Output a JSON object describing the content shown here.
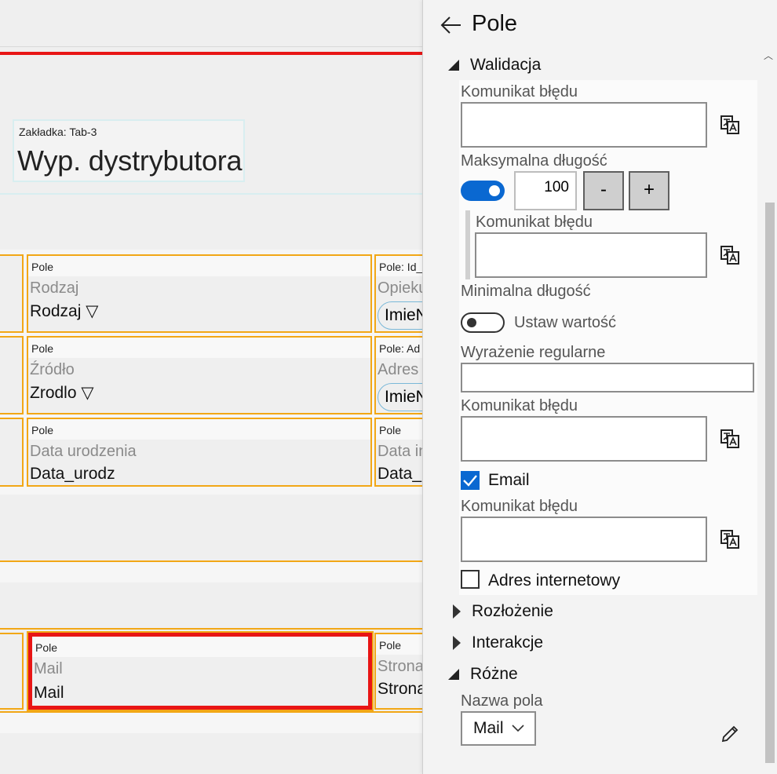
{
  "canvas": {
    "tab": {
      "caption": "Zakładka: Tab-3",
      "title": "Wyp. dystrybutora"
    },
    "fields": [
      {
        "caption": "Pole",
        "label": "Rodzaj",
        "value": "Rodzaj ▽"
      },
      {
        "caption": "Pole: Id_",
        "label": "Opieku",
        "value": "ImieN"
      },
      {
        "caption": "Pole",
        "label": "Źródło",
        "value": "Zrodlo ▽"
      },
      {
        "caption": "Pole: Ad",
        "label": "Adres n",
        "value": "ImieN"
      },
      {
        "caption": "Pole",
        "label": "Data urodzenia",
        "value": "Data_urodz"
      },
      {
        "caption": "Pole",
        "label": "Data in",
        "value": "Data_i"
      },
      {
        "caption": "Pole",
        "label": "Mail",
        "value": "Mail"
      },
      {
        "caption": "Pole",
        "label": "Strona",
        "value": "Strona"
      }
    ]
  },
  "panel": {
    "title": "Pole",
    "sections": {
      "walidacja": "Walidacja",
      "rozlozenie": "Rozłożenie",
      "interakcje": "Interakcje",
      "rozne": "Różne"
    },
    "validation": {
      "error_msg_label": "Komunikat błędu",
      "max_length_label": "Maksymalna długość",
      "max_length_value": "100",
      "max_length_enabled": true,
      "minus_label": "-",
      "plus_label": "+",
      "min_length_label": "Minimalna długość",
      "min_length_toggle_text": "Ustaw wartość",
      "min_length_enabled": false,
      "regex_label": "Wyrażenie regularne",
      "email_label": "Email",
      "email_checked": true,
      "url_label": "Adres internetowy",
      "url_checked": false
    },
    "misc": {
      "field_name_label": "Nazwa pola",
      "field_name_value": "Mail"
    }
  },
  "icons": {
    "back": "arrow-left-icon",
    "translate": "translate-icon",
    "chevron": "chevron-down-icon",
    "edit": "pencil-icon"
  },
  "colors": {
    "accent": "#0a68d1",
    "field_border": "#f2a716",
    "selection": "#e81515"
  }
}
